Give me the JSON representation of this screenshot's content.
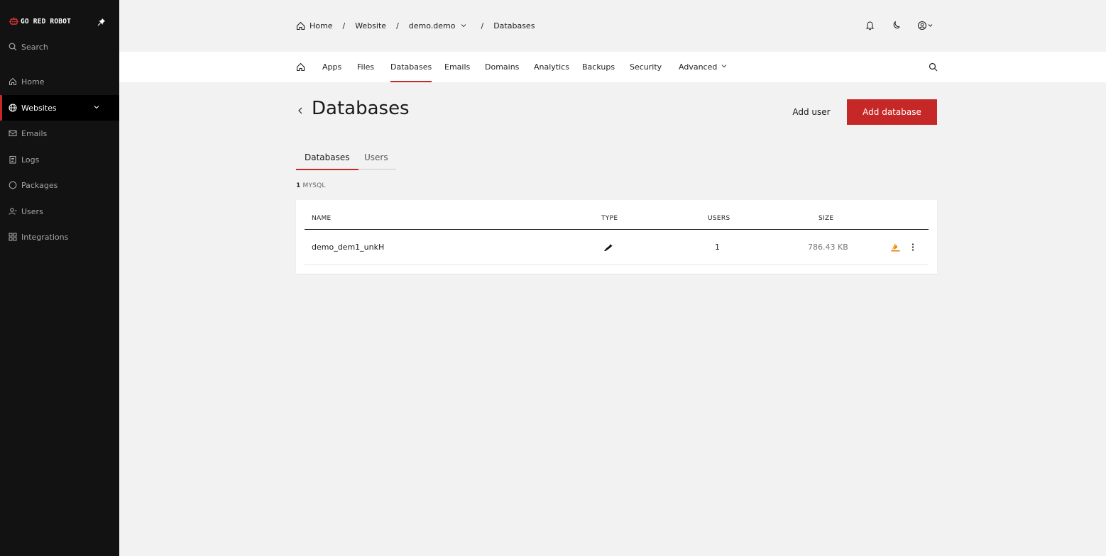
{
  "brand": {
    "name": "GO RED ROBOT",
    "accent": "#c62828"
  },
  "sidebar": {
    "search_label": "Search",
    "items": [
      {
        "label": "Home",
        "icon": "home-icon"
      },
      {
        "label": "Websites",
        "icon": "globe-icon",
        "active": true
      },
      {
        "label": "Emails",
        "icon": "mail-icon"
      },
      {
        "label": "Logs",
        "icon": "log-icon"
      },
      {
        "label": "Packages",
        "icon": "package-icon"
      },
      {
        "label": "Users",
        "icon": "users-icon"
      },
      {
        "label": "Integrations",
        "icon": "integrations-icon"
      }
    ]
  },
  "breadcrumb": {
    "items": [
      "Home",
      "Website",
      "demo.demo",
      "Databases"
    ],
    "separator": "/"
  },
  "tabs": [
    "Apps",
    "Files",
    "Databases",
    "Emails",
    "Domains",
    "Analytics",
    "Backups",
    "Security",
    "Advanced"
  ],
  "active_tab": "Databases",
  "page": {
    "title": "Databases",
    "add_user_label": "Add user",
    "add_database_label": "Add database"
  },
  "subtabs": {
    "databases": "Databases",
    "users": "Users"
  },
  "summary": {
    "count": "1",
    "type": "MYSQL"
  },
  "table": {
    "columns": {
      "name": "NAME",
      "type": "TYPE",
      "users": "USERS",
      "size": "SIZE"
    },
    "rows": [
      {
        "name": "demo_dem1_unkH",
        "type_icon": "mysql-dolphin-icon",
        "users": "1",
        "size": "786.43 KB"
      }
    ]
  }
}
